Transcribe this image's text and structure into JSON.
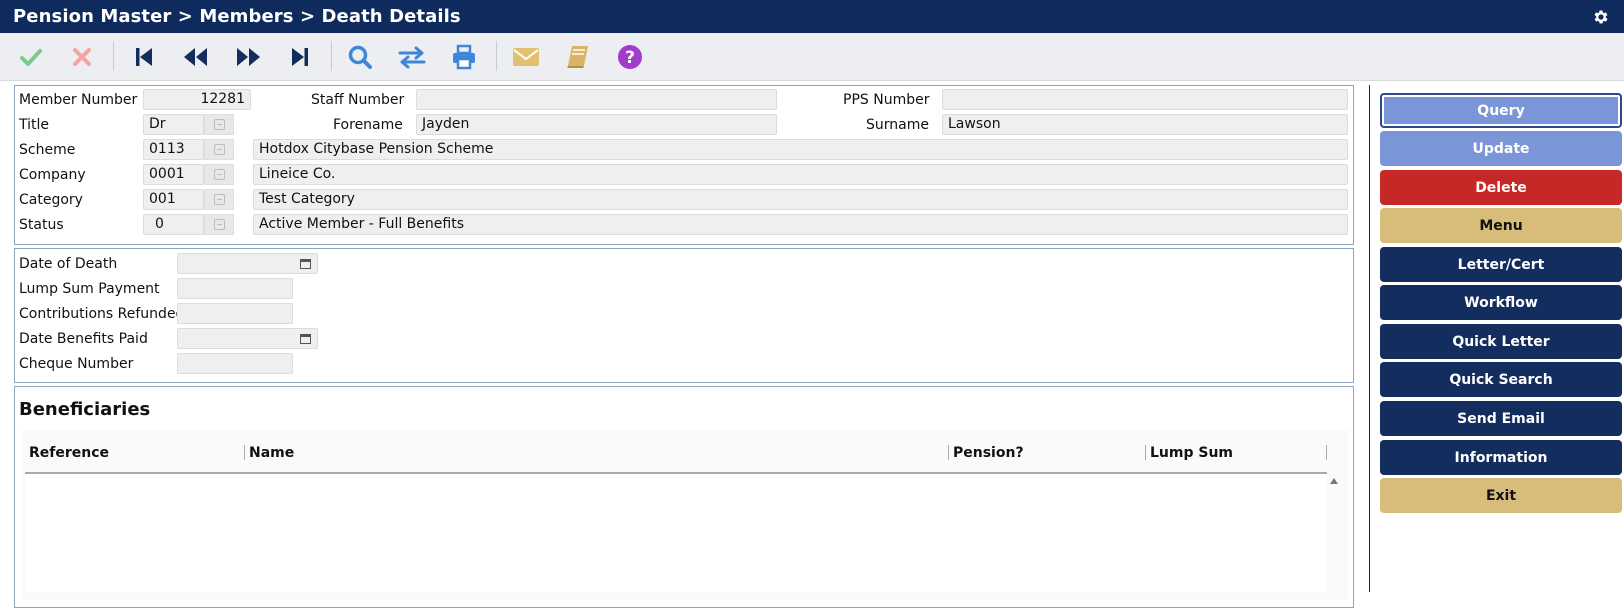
{
  "window": {
    "title": "Pension Master > Members > Death Details"
  },
  "toolbar": {
    "icons": [
      "check-icon",
      "cancel-icon",
      "first-record-icon",
      "previous-record-icon",
      "next-record-icon",
      "last-record-icon",
      "search-icon",
      "swap-icon",
      "print-icon",
      "email-icon",
      "book-icon",
      "help-icon"
    ],
    "colors": {
      "green": "#7ccb8a",
      "pink": "#f2a3a3",
      "navy": "#132d5e",
      "blue": "#3f86d8",
      "gold": "#e2c16e",
      "purple": "#a13dc8"
    }
  },
  "member": {
    "member_number_label": "Member Number",
    "member_number": "12281",
    "staff_number_label": "Staff Number",
    "staff_number": "",
    "pps_number_label": "PPS Number",
    "pps_number": "",
    "title_label": "Title",
    "title": "Dr",
    "forename_label": "Forename",
    "forename": "Jayden",
    "surname_label": "Surname",
    "surname": "Lawson",
    "scheme_label": "Scheme",
    "scheme_code": "0113",
    "scheme_name": "Hotdox Citybase Pension Scheme",
    "company_label": "Company",
    "company_code": "0001",
    "company_name": "Lineice Co.",
    "category_label": "Category",
    "category_code": "001",
    "category_name": "Test Category",
    "status_label": "Status",
    "status_code": "0",
    "status_name": "Active Member - Full Benefits"
  },
  "death": {
    "date_of_death_label": "Date of Death",
    "date_of_death": "",
    "lump_sum_payment_label": "Lump Sum Payment",
    "lump_sum_payment": "",
    "contributions_refunded_label": "Contributions Refunded",
    "contributions_refunded": "",
    "date_benefits_paid_label": "Date Benefits Paid",
    "date_benefits_paid": "",
    "cheque_number_label": "Cheque Number",
    "cheque_number": ""
  },
  "beneficiaries": {
    "heading": "Beneficiaries",
    "columns": [
      "Reference",
      "Name",
      "Pension?",
      "Lump Sum"
    ],
    "rows": []
  },
  "sidebar": {
    "buttons": [
      "Query",
      "Update",
      "Delete",
      "Menu",
      "Letter/Cert",
      "Workflow",
      "Quick Letter",
      "Quick Search",
      "Send Email",
      "Information",
      "Exit"
    ]
  },
  "colors": {
    "header": "#0f2a5c",
    "navy_button": "#132d5e",
    "gold_button": "#d8bd7a",
    "light_blue_button": "#7b96d8",
    "red_button": "#c62828"
  }
}
